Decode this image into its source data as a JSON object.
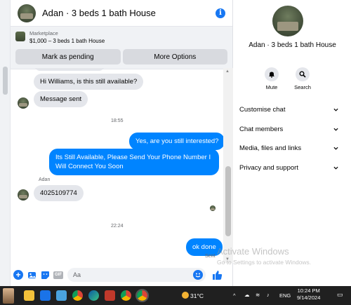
{
  "header": {
    "title": "Adan · 3 beds 1 bath House"
  },
  "marketplace": {
    "label": "Marketplace",
    "listing": "$1,000 – 3 beds 1 bath House",
    "mark_pending_label": "Mark as pending",
    "more_options_label": "More Options"
  },
  "messages": {
    "in_1": "Hi Williams, is this still available?",
    "in_2": "Message sent",
    "time_1": "18:55",
    "out_1": "Yes, are you still interested?",
    "out_2": "Its Still Available, Please Send Your Phone Number I Will Connect You Soon",
    "sender_name": "Adan",
    "in_3": "4025109774",
    "time_2": "22:24",
    "out_3": "ok done",
    "status": "Sent"
  },
  "composer": {
    "placeholder": "Aa"
  },
  "details": {
    "name": "Adan · 3 beds 1 bath House",
    "mute_label": "Mute",
    "search_label": "Search",
    "menu": [
      "Customise chat",
      "Chat members",
      "Media, files and links",
      "Privacy and support"
    ]
  },
  "watermark": {
    "title": "Activate Windows",
    "subtitle": "Go to Settings to activate Windows."
  },
  "taskbar": {
    "temperature": "31°C",
    "language": "ENG",
    "time": "10:24 PM",
    "date": "9/14/2024",
    "icons": [
      "file-explorer-icon",
      "mail-icon",
      "store-icon",
      "chrome-icon",
      "edge-icon",
      "snipping-icon",
      "chrome-profile-icon",
      "chrome-active-icon"
    ]
  },
  "colors": {
    "accent": "#0084ff",
    "brand_blue": "#1877f2",
    "bubble_in": "#e4e6eb",
    "taskbar": "#202020"
  }
}
